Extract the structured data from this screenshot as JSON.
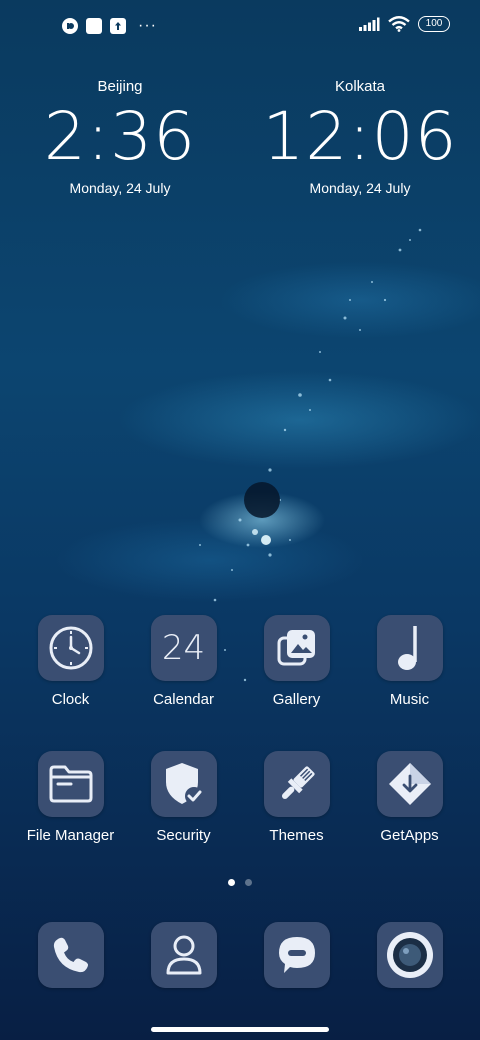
{
  "status_bar": {
    "left_icons": [
      "app-notification-icon",
      "square-notification-icon",
      "upload-notification-icon"
    ],
    "overflow": "···",
    "signal_icon": "signal-bars-icon",
    "wifi_icon": "wifi-icon",
    "battery": "100"
  },
  "clocks": [
    {
      "city": "Beijing",
      "time": "2:36",
      "date": "Monday, 24 July"
    },
    {
      "city": "Kolkata",
      "time": "12:06",
      "date": "Monday, 24 July"
    }
  ],
  "apps": [
    {
      "label": "Clock",
      "icon": "clock-icon"
    },
    {
      "label": "Calendar",
      "icon": "calendar-icon",
      "icon_text": "24"
    },
    {
      "label": "Gallery",
      "icon": "gallery-icon"
    },
    {
      "label": "Music",
      "icon": "music-note-icon"
    },
    {
      "label": "File Manager",
      "icon": "folder-icon"
    },
    {
      "label": "Security",
      "icon": "shield-check-icon"
    },
    {
      "label": "Themes",
      "icon": "paintbrush-icon"
    },
    {
      "label": "GetApps",
      "icon": "download-arrow-icon"
    }
  ],
  "page_indicator": {
    "pages": 2,
    "current": 1
  },
  "dock": [
    {
      "name": "Phone",
      "icon": "phone-icon"
    },
    {
      "name": "Contacts",
      "icon": "person-icon"
    },
    {
      "name": "Messages",
      "icon": "chat-bubble-icon"
    },
    {
      "name": "Camera",
      "icon": "camera-lens-icon"
    }
  ],
  "colors": {
    "icon_tile": "#3a4e72",
    "glyph": "#e9eef7",
    "wallpaper_top": "#0a3a5f",
    "wallpaper_bottom": "#081f44"
  }
}
